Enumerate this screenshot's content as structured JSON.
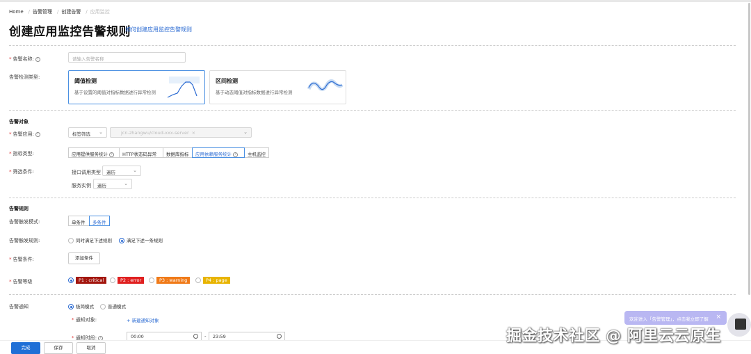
{
  "breadcrumb": [
    "Home",
    "告警管理",
    "创建告警",
    "应用监控"
  ],
  "page_title": "创建应用监控告警规则",
  "help_link": "如何创建应用监控告警规则",
  "name_field": {
    "label": "告警名称:",
    "placeholder": "请输入告警名称"
  },
  "detect_type": {
    "label": "告警检测类型:",
    "cards": [
      {
        "title": "阈值检测",
        "desc": "基于设置的阈值对指标数据进行异常检测",
        "selected": true
      },
      {
        "title": "区间检测",
        "desc": "基于动态阈值对指标数据进行异常检测",
        "selected": false
      }
    ]
  },
  "target_section": {
    "title": "告警对象",
    "app_label": "告警应用:",
    "app_filter": "标签筛选",
    "app_value": "jcn-zhangwu/cloud-xxx-server",
    "metric_label": "指标类型:",
    "metric_types": [
      {
        "label": "应用提供服务统计",
        "help": true,
        "active": false
      },
      {
        "label": "HTTP状态码异常",
        "help": false,
        "active": false
      },
      {
        "label": "数据库指标",
        "help": false,
        "active": false
      },
      {
        "label": "应用依赖服务统计",
        "help": true,
        "active": true
      },
      {
        "label": "主机监控",
        "help": false,
        "active": false
      }
    ],
    "filter_label": "筛选条件:",
    "filters": [
      {
        "label": "接口调用类型",
        "value": "遍历"
      },
      {
        "label": "服务实例",
        "value": "遍历"
      }
    ]
  },
  "rule_section": {
    "title": "告警规则",
    "trigger_mode_label": "告警触发模式:",
    "trigger_modes": [
      {
        "label": "单条件",
        "active": false
      },
      {
        "label": "多条件",
        "active": true
      }
    ],
    "trigger_rule_label": "告警触发规则:",
    "trigger_rules": [
      {
        "label": "同时满足下述规则",
        "checked": false
      },
      {
        "label": "满足下述一条规则",
        "checked": true
      }
    ],
    "condition_label": "告警条件:",
    "add_condition": "添加条件",
    "level_label": "告警等级",
    "levels": [
      {
        "label": "P1 : critical",
        "color": "#a3160e",
        "checked": true
      },
      {
        "label": "P2 : error",
        "color": "#e02020",
        "checked": false
      },
      {
        "label": "P3 : warning",
        "color": "#f07a18",
        "checked": false
      },
      {
        "label": "P4 : page",
        "color": "#e8b400",
        "checked": false
      }
    ]
  },
  "notify_section": {
    "label": "告警通知",
    "modes": [
      {
        "label": "极简模式",
        "checked": true
      },
      {
        "label": "普通模式",
        "checked": false
      }
    ],
    "target_label": "通知对象:",
    "new_target": "+ 新建通知对象",
    "time_label": "通知时段:",
    "start_time": "00:00",
    "end_time": "23:59",
    "range_sep": "-"
  },
  "footer": {
    "finish": "完成",
    "save": "保存",
    "cancel": "取消"
  },
  "toast": {
    "text": "欢迎进入「告警管理」，点击我立即了解",
    "close": "×"
  },
  "watermark": "掘金技术社区 @ 阿里云云原生",
  "colors": {
    "accent": "#1f6fd6",
    "link": "#2a6ad2"
  }
}
